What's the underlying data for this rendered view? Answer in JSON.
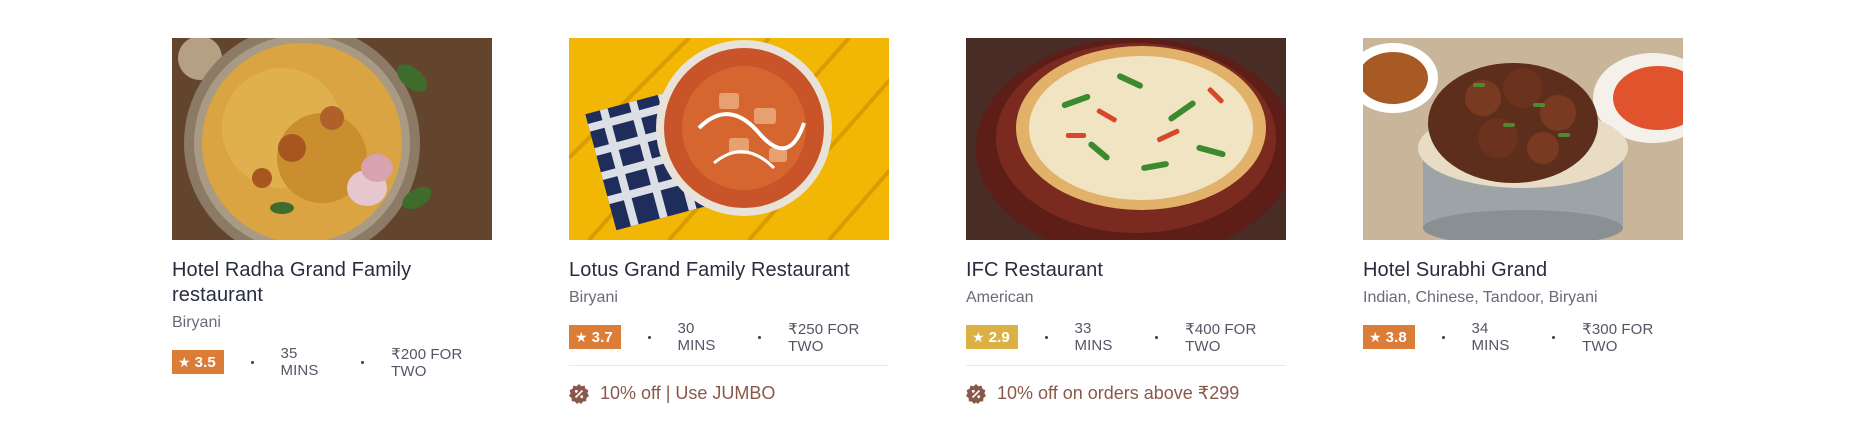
{
  "colors": {
    "rating_orange": "#db7c38",
    "rating_yellow": "#dbb045",
    "offer_text": "#8a584b",
    "title_text": "#282c3f",
    "sub_text": "#686b78"
  },
  "restaurants": [
    {
      "name": "Hotel Radha Grand Family restaurant",
      "cuisine": "Biryani",
      "rating": "3.5",
      "rating_color": "#db7c38",
      "time": "35 MINS",
      "cost": "₹200 FOR TWO",
      "offer": "",
      "image": "biryani-dish-image"
    },
    {
      "name": "Lotus Grand Family Restaurant",
      "cuisine": "Biryani",
      "rating": "3.7",
      "rating_color": "#db7c38",
      "time": "30 MINS",
      "cost": "₹250 FOR TWO",
      "offer": "10% off | Use JUMBO",
      "image": "paneer-curry-image"
    },
    {
      "name": "IFC Restaurant",
      "cuisine": "American",
      "rating": "2.9",
      "rating_color": "#dbb045",
      "time": "33 MINS",
      "cost": "₹400 FOR TWO",
      "offer": "10% off on orders above ₹299",
      "image": "pizza-image"
    },
    {
      "name": "Hotel Surabhi Grand",
      "cuisine": "Indian, Chinese, Tandoor, Biryani",
      "rating": "3.8",
      "rating_color": "#db7c38",
      "time": "34 MINS",
      "cost": "₹300 FOR TWO",
      "offer": "",
      "image": "chicken-biryani-image"
    }
  ]
}
